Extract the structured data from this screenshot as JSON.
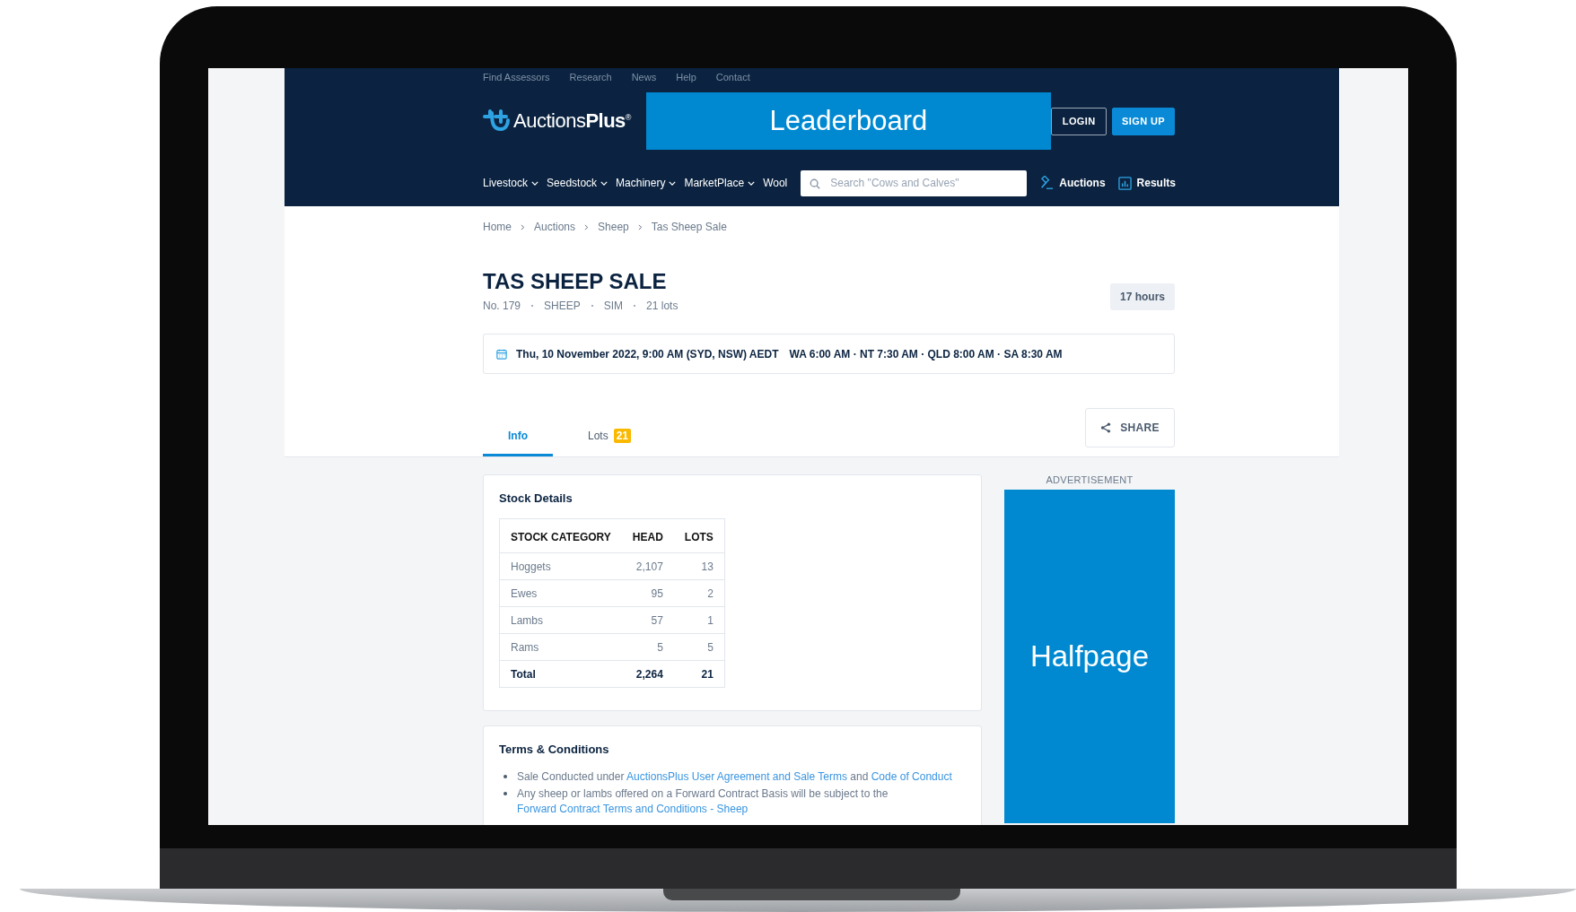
{
  "utility_nav": [
    "Find Assessors",
    "Research",
    "News",
    "Help",
    "Contact"
  ],
  "header": {
    "logo": "Auctions**Plus**$^{®}$",
    "leaderboard_ad": "Leaderboard",
    "auth_buttons": [
      {
        "label": "LOGIN",
        "kind": "outline"
      },
      {
        "label": "SIGN UP",
        "kind": "primary"
      }
    ]
  },
  "nav_menu": [
    {
      "label": "Livestock",
      "dropdown": true
    },
    {
      "label": "Seedstock",
      "dropdown": true
    },
    {
      "label": "Machinery",
      "dropdown": true
    },
    {
      "label": "MarketPlace",
      "dropdown": true
    },
    {
      "label": "Wool",
      "dropdown": false
    }
  ],
  "search": {
    "placeholder": "Search \"Cows and Calves\""
  },
  "nav_links": [
    {
      "label": "Auctions",
      "kind": "auctions"
    },
    {
      "label": "Results",
      "kind": "results"
    }
  ],
  "breadcrumbs": [
    "Home",
    "Auctions",
    "Sheep",
    "Tas Sheep Sale"
  ],
  "sale": {
    "title": "TAS SHEEP SALE",
    "meta": [
      "No. 179",
      "SHEEP",
      "SIM",
      "21 lots"
    ],
    "time_left": "17 hours",
    "date": "Thu, 10 November 2022, 9:00 AM (SYD, NSW) AEDT",
    "other_times": "WA 6:00 AM · NT 7:30 AM · QLD 8:00 AM · SA 8:30 AM"
  },
  "tabs": [
    {
      "label": "Info",
      "selected": true
    },
    {
      "label": "Lots",
      "badge": "21",
      "selected": false
    }
  ],
  "share_button": "SHARE",
  "stock_details": {
    "title": "Stock Details",
    "columns": [
      "STOCK CATEGORY",
      "HEAD",
      "LOTS"
    ],
    "rows": [
      [
        "Hoggets",
        "2,107",
        "13"
      ],
      [
        "Ewes",
        "95",
        "2"
      ],
      [
        "Lambs",
        "57",
        "1"
      ],
      [
        "Rams",
        "5",
        "5"
      ]
    ],
    "total": [
      "Total",
      "2,264",
      "21"
    ]
  },
  "advertisement": {
    "label": "ADVERTISEMENT",
    "ad": "Halfpage"
  },
  "terms": {
    "title": "Terms & Conditions",
    "items": [
      [
        {
          "kind": "text",
          "text": "Sale Conducted under "
        },
        {
          "kind": "link",
          "text": "AuctionsPlus User Agreement and Sale Terms"
        },
        {
          "kind": "text",
          "text": " and "
        },
        {
          "kind": "link",
          "text": "Code of Conduct"
        }
      ],
      [
        {
          "kind": "text",
          "text": "Any sheep or lambs offered on a Forward Contract Basis will be subject to the "
        },
        {
          "kind": "link",
          "text": "Forward Contract Terms and Conditions - Sheep"
        }
      ]
    ]
  }
}
